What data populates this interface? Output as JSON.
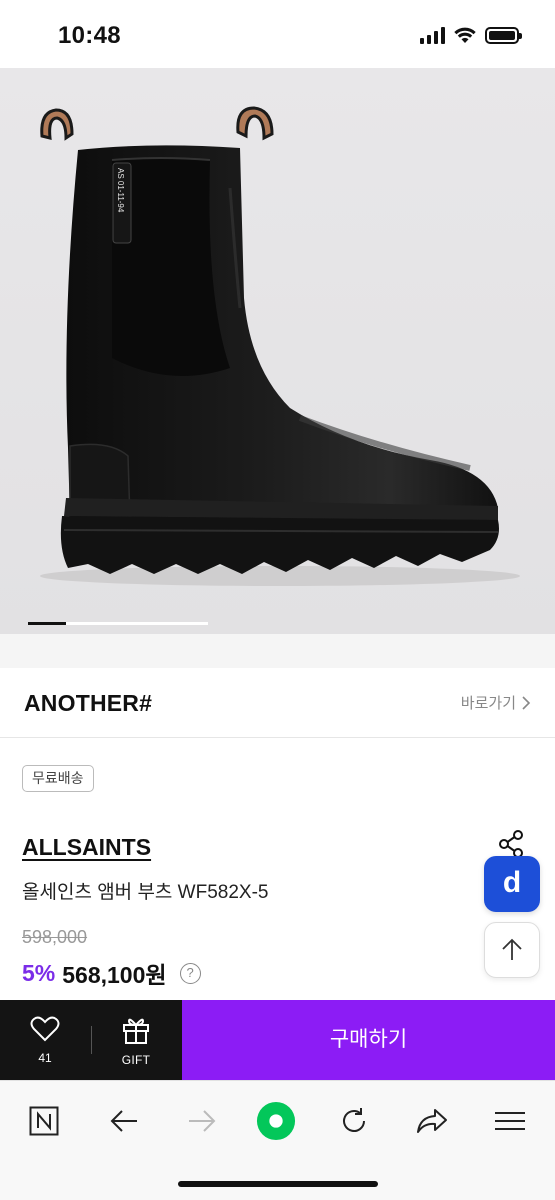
{
  "status_bar": {
    "time": "10:48"
  },
  "product_image": {
    "alt": "black leather chelsea boot",
    "print_text": "AS 01-11-94",
    "slide_index": 1,
    "slide_count": 5
  },
  "shop": {
    "logo": "ANOTHER#",
    "link_label": "바로가기"
  },
  "badge": {
    "label": "무료배송"
  },
  "product": {
    "brand": "ALLSAINTS",
    "name": "올세인츠 앰버 부츠 WF582X-5",
    "original_price": "598,000",
    "discount": "5%",
    "price": "568,100원",
    "info_icon": "?"
  },
  "floating": {
    "d_label": "d",
    "share_icon": "share-icon",
    "top_icon": "arrow-up-icon"
  },
  "purchase_bar": {
    "like_count": "41",
    "gift_label": "GIFT",
    "buy_label": "구매하기"
  },
  "colors": {
    "accent": "#8c1cf5",
    "discount": "#7b2de8",
    "d_button": "#1d4fd8",
    "naver_green": "#03c75a"
  }
}
